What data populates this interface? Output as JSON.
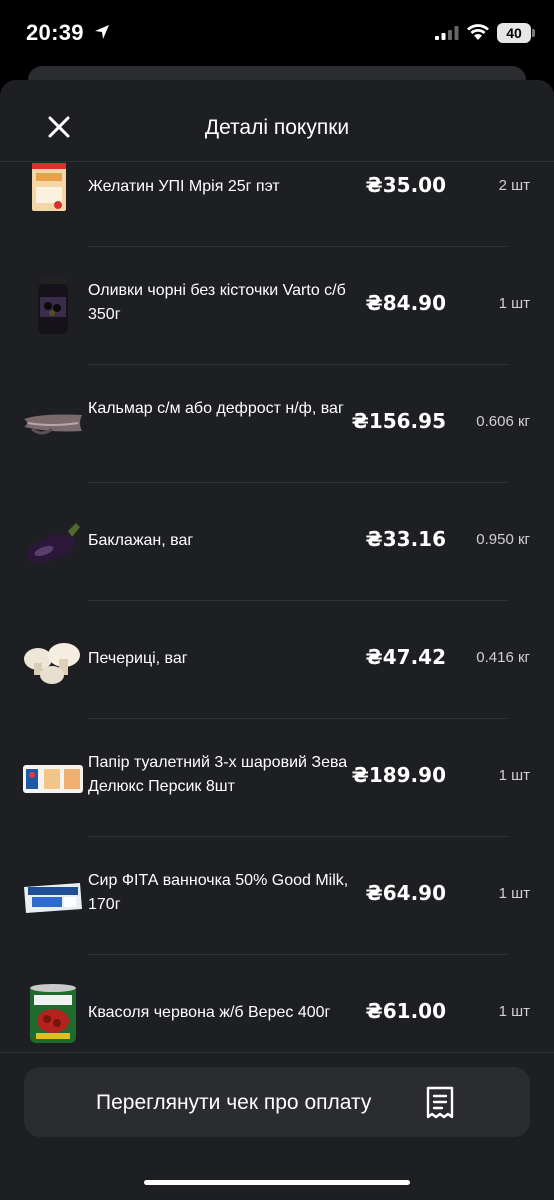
{
  "status_bar": {
    "time": "20:39",
    "battery": "40"
  },
  "sheet": {
    "title": "Деталі покупки"
  },
  "items": [
    {
      "name": "Желатин УПІ Мрія 25г пэт",
      "price": "₴35.00",
      "qty": "2 шт",
      "icon": "gelatin-pack-icon"
    },
    {
      "name": "Оливки чорні без кісточки Varto с/б 350г",
      "price": "₴84.90",
      "qty": "1 шт",
      "icon": "olives-jar-icon"
    },
    {
      "name": "Кальмар с/м або дефрост н/ф, ваг",
      "price": "₴156.95",
      "qty": "0.606 кг",
      "icon": "squid-icon"
    },
    {
      "name": "Баклажан, ваг",
      "price": "₴33.16",
      "qty": "0.950 кг",
      "icon": "eggplant-icon"
    },
    {
      "name": "Печериці, ваг",
      "price": "₴47.42",
      "qty": "0.416 кг",
      "icon": "mushrooms-icon"
    },
    {
      "name": "Папір туалетний 3-х шаровий Зева Делюкс Персик 8шт",
      "price": "₴189.90",
      "qty": "1 шт",
      "icon": "toilet-paper-pack-icon"
    },
    {
      "name": "Сир ФІТА ванночка 50% Good Milk, 170г",
      "price": "₴64.90",
      "qty": "1 шт",
      "icon": "cheese-tub-icon"
    },
    {
      "name": "Квасоля червона ж/б Верес 400г",
      "price": "₴61.00",
      "qty": "1 шт",
      "icon": "beans-can-icon"
    }
  ],
  "footer": {
    "receipt_button_label": "Переглянути чек про оплату"
  }
}
